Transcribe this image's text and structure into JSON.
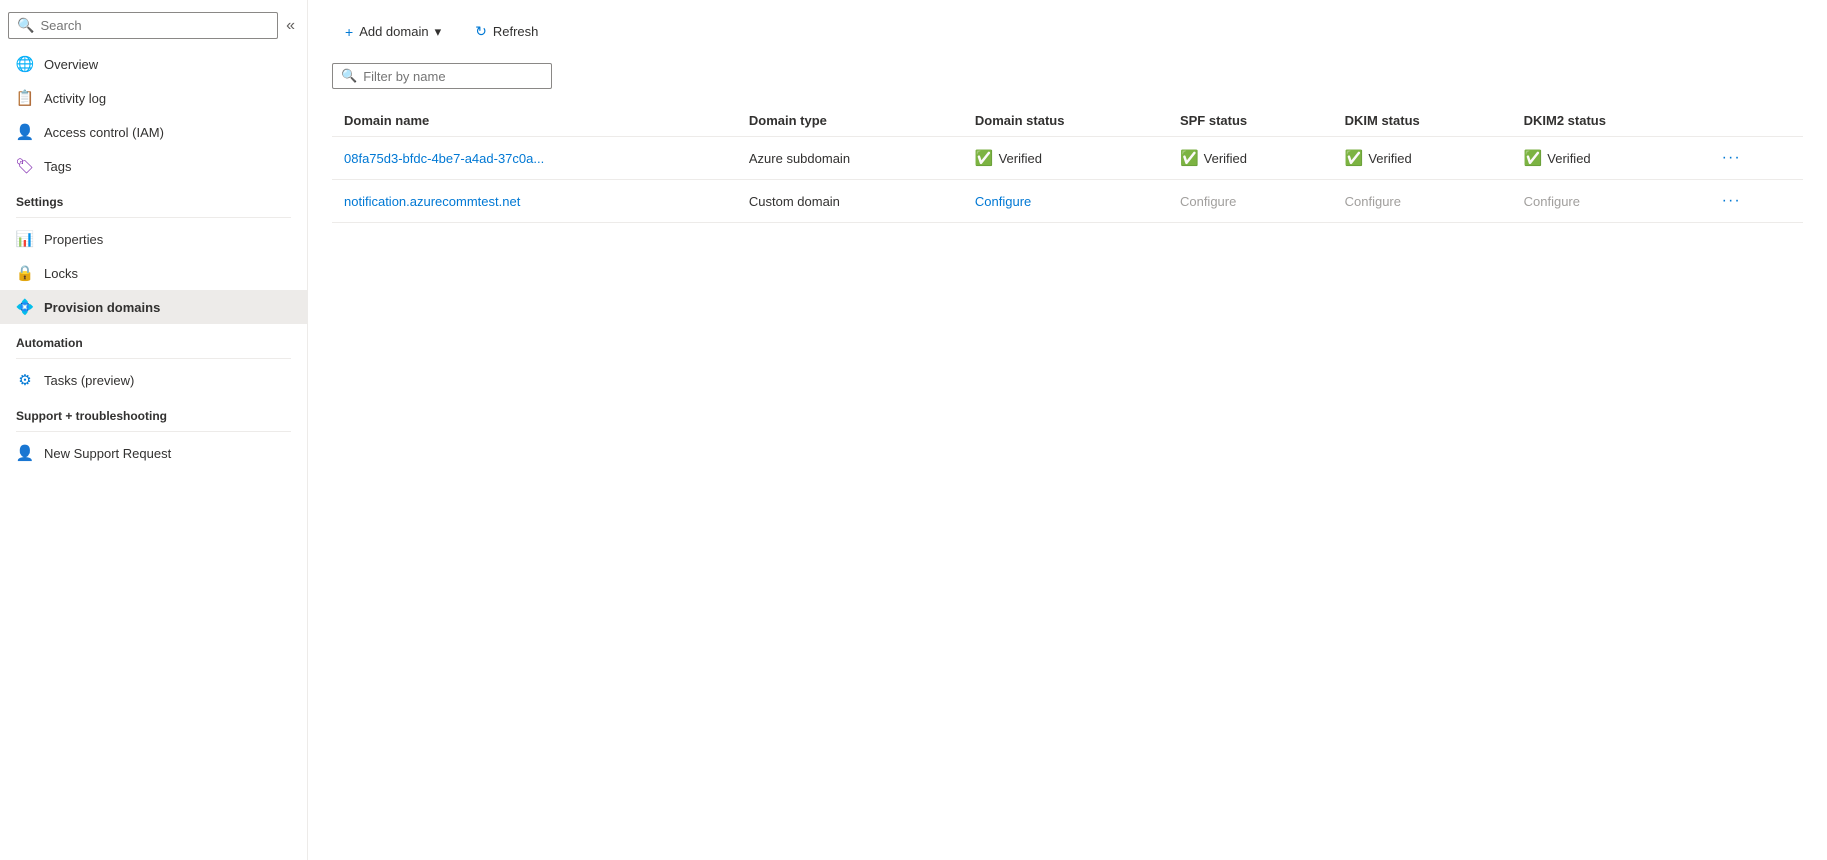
{
  "sidebar": {
    "search_placeholder": "Search",
    "collapse_icon": "«",
    "nav_items": [
      {
        "id": "overview",
        "label": "Overview",
        "icon": "🌐",
        "active": false
      },
      {
        "id": "activity-log",
        "label": "Activity log",
        "icon": "📋",
        "active": false
      },
      {
        "id": "access-control",
        "label": "Access control (IAM)",
        "icon": "👤",
        "active": false
      },
      {
        "id": "tags",
        "label": "Tags",
        "icon": "🏷",
        "active": false
      }
    ],
    "sections": [
      {
        "label": "Settings",
        "items": [
          {
            "id": "properties",
            "label": "Properties",
            "icon": "📊"
          },
          {
            "id": "locks",
            "label": "Locks",
            "icon": "🔒"
          },
          {
            "id": "provision-domains",
            "label": "Provision domains",
            "icon": "💠",
            "active": true
          }
        ]
      },
      {
        "label": "Automation",
        "items": [
          {
            "id": "tasks",
            "label": "Tasks (preview)",
            "icon": "⚙"
          }
        ]
      },
      {
        "label": "Support + troubleshooting",
        "items": [
          {
            "id": "new-support",
            "label": "New Support Request",
            "icon": "👤"
          }
        ]
      }
    ]
  },
  "toolbar": {
    "add_domain_label": "Add domain",
    "add_domain_icon": "+",
    "dropdown_icon": "▾",
    "refresh_label": "Refresh",
    "refresh_icon": "↻"
  },
  "filter": {
    "placeholder": "Filter by name",
    "search_icon": "🔍"
  },
  "table": {
    "columns": [
      {
        "id": "domain-name",
        "label": "Domain name"
      },
      {
        "id": "domain-type",
        "label": "Domain type"
      },
      {
        "id": "domain-status",
        "label": "Domain status"
      },
      {
        "id": "spf-status",
        "label": "SPF status"
      },
      {
        "id": "dkim-status",
        "label": "DKIM status"
      },
      {
        "id": "dkim2-status",
        "label": "DKIM2 status"
      }
    ],
    "rows": [
      {
        "id": "row-1",
        "domain_name": "08fa75d3-bfdc-4be7-a4ad-37c0a...",
        "domain_type": "Azure subdomain",
        "domain_status": "Verified",
        "domain_status_type": "verified",
        "spf_status": "Verified",
        "spf_status_type": "verified",
        "dkim_status": "Verified",
        "dkim_status_type": "verified",
        "dkim2_status": "Verified",
        "dkim2_status_type": "verified"
      },
      {
        "id": "row-2",
        "domain_name": "notification.azurecommtest.net",
        "domain_type": "Custom domain",
        "domain_status": "Configure",
        "domain_status_type": "configure-blue",
        "spf_status": "Configure",
        "spf_status_type": "configure-gray",
        "dkim_status": "Configure",
        "dkim_status_type": "configure-gray",
        "dkim2_status": "Configure",
        "dkim2_status_type": "configure-gray"
      }
    ]
  }
}
